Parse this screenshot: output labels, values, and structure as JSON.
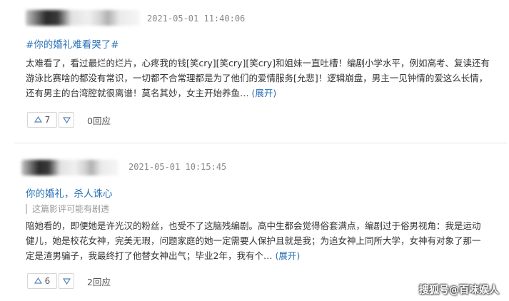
{
  "reviews": [
    {
      "date": "2021-05-01 11:40:06",
      "title": "#你的婚礼难看哭了#",
      "notice": "",
      "lines": [
        "太难看了，看过最烂的烂片，心疼我的钱[笑cry][笑cry][笑cry]和姐妹一直吐槽！编剧小学水平，例如高考、复读还有",
        "游泳比赛啥的都没有常识，一切都不合常理都是为了他们的爱情服务[允悲]！逻辑崩盘，男主一见钟情的爱这么长情，",
        "还有男主的台湾腔就很离谱！莫名其妙，女主开始养鱼…"
      ],
      "expand": "(展开)",
      "upvotes": "7",
      "reply": "0回应"
    },
    {
      "date": "2021-05-01 10:15:45",
      "title": "你的婚礼，杀人诛心",
      "notice": "这篇影评可能有剧透",
      "lines": [
        "陪她看的，即便她是许光汉的粉丝，也受不了这脑残编剧。高中生都会觉得俗套满点，编剧过于俗男视角：我是运动",
        "健儿，她是校花女神，完美无瑕，问题家庭的她一定需要人保护且就是我；为追女神上同所大学，女神有对象了那一",
        "定是渣男骗子，我最终打了他替女神出气；毕业2年，我有个…"
      ],
      "expand": "(展开)",
      "upvotes": "6",
      "reply": "2回应"
    }
  ],
  "watermark": "搜狐号@百味娱人",
  "icons": {
    "up": "triangle-up-icon",
    "down": "triangle-down-icon"
  },
  "colors": {
    "link": "#2a70b8",
    "text": "#333333",
    "meta": "#888888"
  }
}
